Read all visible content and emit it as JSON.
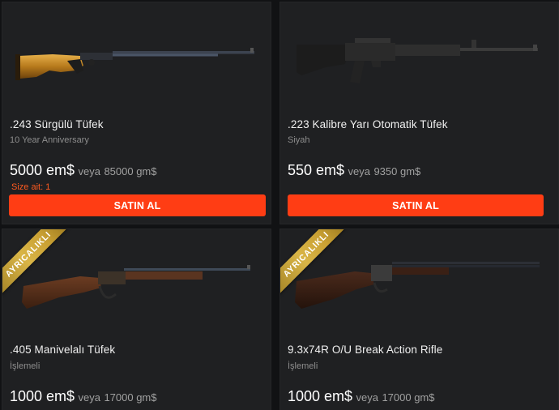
{
  "products": [
    {
      "name": ".243 Sürgülü Tüfek",
      "variant": "10 Year Anniversary",
      "price_em": "5000 em$",
      "price_sep": "veya",
      "price_gm": "85000 gm$",
      "size_note": "Size ait: 1",
      "buy_label": "SATIN AL",
      "icon": "bolt-action-rifle-gold"
    },
    {
      "name": ".223 Kalibre Yarı Otomatik Tüfek",
      "variant": "Siyah",
      "price_em": "550 em$",
      "price_sep": "veya",
      "price_gm": "9350 gm$",
      "buy_label": "SATIN AL",
      "icon": "semi-auto-rifle-black"
    },
    {
      "ribbon": "AYRICALIKLI",
      "name": ".405 Manivelalı Tüfek",
      "variant": "İşlemeli",
      "price_em": "1000 em$",
      "price_sep": "veya",
      "price_gm": "17000 gm$",
      "icon": "lever-action-rifle"
    },
    {
      "ribbon": "AYRICALIKLI",
      "name": "9.3x74R O/U Break Action Rifle",
      "variant": "İşlemeli",
      "price_em": "1000 em$",
      "price_sep": "veya",
      "price_gm": "17000 gm$",
      "icon": "break-action-rifle"
    }
  ],
  "colors": {
    "background": "#111214",
    "card": "#1f2022",
    "buy_button": "#ff3d14",
    "size_note": "#ff5a1f",
    "ribbon_gold": "#d9b547"
  }
}
